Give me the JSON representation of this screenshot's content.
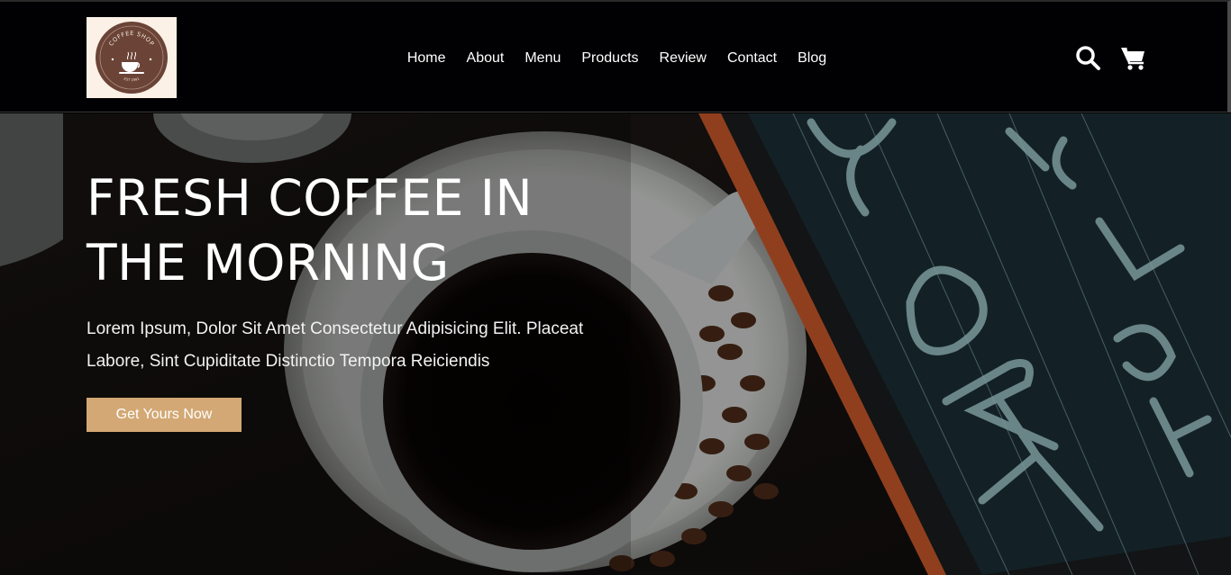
{
  "logo": {
    "top_text": "COFFEE SHOP",
    "bottom_text": "EST 1991"
  },
  "nav": {
    "items": [
      "Home",
      "About",
      "Menu",
      "Products",
      "Review",
      "Contact",
      "Blog"
    ]
  },
  "icons": [
    "search-icon",
    "cart-icon"
  ],
  "hero": {
    "title": "FRESH COFFEE IN THE MORNING",
    "text": "Lorem Ipsum, Dolor Sit Amet Consectetur Adipisicing Elit. Placeat Labore, Sint Cupiditate Distinctio Tempora Reiciendis",
    "cta_label": "Get Yours Now"
  },
  "colors": {
    "accent": "#d3a874",
    "header_bg": "#010103",
    "logo_bg": "#fbf1e6",
    "logo_circle": "#6b4337"
  }
}
